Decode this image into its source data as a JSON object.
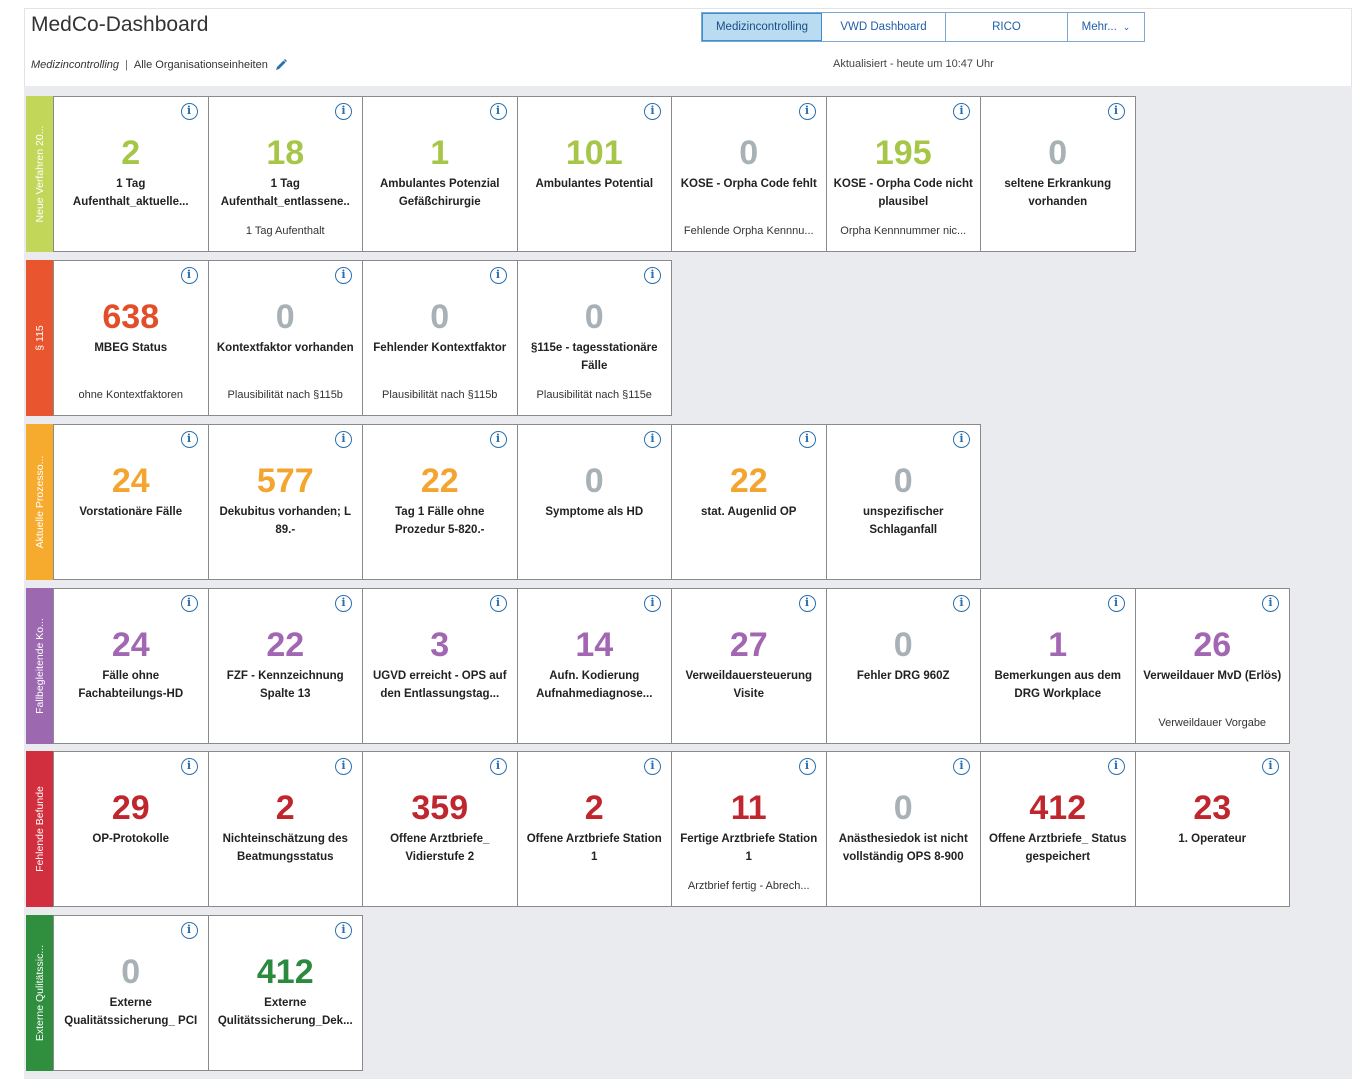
{
  "app": {
    "title": "MedCo-Dashboard",
    "context_label": "Medizincontrolling",
    "separator": "|",
    "org_label": "Alle Organisationseinheiten",
    "updated_text": "Aktualisiert - heute um 10:47 Uhr"
  },
  "tabs": [
    {
      "label": "Medizincontrolling",
      "active": true
    },
    {
      "label": "VWD Dashboard",
      "active": false
    },
    {
      "label": "RICO",
      "active": false
    },
    {
      "label": "Mehr...",
      "active": false
    }
  ],
  "colors": {
    "green": "#a6c648",
    "grey": "#a8b1b6",
    "orange_red": "#e24e2a",
    "orange": "#f4a530",
    "purple": "#a266b3",
    "red": "#c0262d",
    "dark_green": "#2a8a3e",
    "band_new": "#c2d75a",
    "band_115": "#e9552f",
    "band_process": "#f6ab2f",
    "band_case": "#9c68b0",
    "band_missing": "#d12e3e",
    "band_external": "#2f8f3e"
  },
  "rows": [
    {
      "band_label": "Neue Verfahren 20...",
      "band_color": "#c2d75a",
      "tiles": [
        {
          "value": "2",
          "color": "#a6c648",
          "label": "1 Tag Aufenthalt_aktuelle...",
          "sub": ""
        },
        {
          "value": "18",
          "color": "#a6c648",
          "label": "1 Tag Aufenthalt_entlassene..",
          "sub": "1 Tag Aufenthalt"
        },
        {
          "value": "1",
          "color": "#a6c648",
          "label": "Ambulantes Potenzial Gefäßchirurgie",
          "sub": ""
        },
        {
          "value": "101",
          "color": "#a6c648",
          "label": "Ambulantes Potential",
          "sub": ""
        },
        {
          "value": "0",
          "color": "#a8b1b6",
          "label": "KOSE - Orpha Code fehlt",
          "sub": "Fehlende Orpha Kennnu..."
        },
        {
          "value": "195",
          "color": "#a6c648",
          "label": "KOSE - Orpha Code nicht plausibel",
          "sub": "Orpha Kennnummer nic..."
        },
        {
          "value": "0",
          "color": "#a8b1b6",
          "label": "seltene Erkrankung vorhanden",
          "sub": ""
        }
      ]
    },
    {
      "band_label": "§ 115",
      "band_color": "#e9552f",
      "tiles": [
        {
          "value": "638",
          "color": "#e24e2a",
          "label": "MBEG Status",
          "sub": "ohne Kontextfaktoren"
        },
        {
          "value": "0",
          "color": "#a8b1b6",
          "label": "Kontextfaktor vorhanden",
          "sub": "Plausibilität nach §115b"
        },
        {
          "value": "0",
          "color": "#a8b1b6",
          "label": "Fehlender Kontextfaktor",
          "sub": "Plausibilität nach §115b"
        },
        {
          "value": "0",
          "color": "#a8b1b6",
          "label": "§115e - tagesstationäre Fälle",
          "sub": "Plausibilität nach §115e"
        }
      ]
    },
    {
      "band_label": "Aktuelle Prozesso...",
      "band_color": "#f6ab2f",
      "tiles": [
        {
          "value": "24",
          "color": "#f4a530",
          "label": "Vorstationäre Fälle",
          "sub": ""
        },
        {
          "value": "577",
          "color": "#f4a530",
          "label": "Dekubitus vorhanden; L 89.-",
          "sub": ""
        },
        {
          "value": "22",
          "color": "#f4a530",
          "label": "Tag 1 Fälle ohne Prozedur 5-820.-",
          "sub": ""
        },
        {
          "value": "0",
          "color": "#a8b1b6",
          "label": "Symptome als HD",
          "sub": ""
        },
        {
          "value": "22",
          "color": "#f4a530",
          "label": "stat. Augenlid OP",
          "sub": ""
        },
        {
          "value": "0",
          "color": "#a8b1b6",
          "label": "unspezifischer Schlaganfall",
          "sub": ""
        }
      ]
    },
    {
      "band_label": "Fallbegleitende Ko...",
      "band_color": "#9c68b0",
      "tiles": [
        {
          "value": "24",
          "color": "#a266b3",
          "label": "Fälle ohne Fachabteilungs-HD",
          "sub": ""
        },
        {
          "value": "22",
          "color": "#a266b3",
          "label": "FZF - Kennzeichnung Spalte 13",
          "sub": ""
        },
        {
          "value": "3",
          "color": "#a266b3",
          "label": "UGVD erreicht - OPS auf den Entlassungstag...",
          "sub": ""
        },
        {
          "value": "14",
          "color": "#a266b3",
          "label": "Aufn. Kodierung Aufnahmediagnose...",
          "sub": ""
        },
        {
          "value": "27",
          "color": "#a266b3",
          "label": "Verweildauersteuerung Visite",
          "sub": ""
        },
        {
          "value": "0",
          "color": "#a8b1b6",
          "label": "Fehler DRG 960Z",
          "sub": ""
        },
        {
          "value": "1",
          "color": "#a266b3",
          "label": "Bemerkungen aus dem DRG Workplace",
          "sub": ""
        },
        {
          "value": "26",
          "color": "#a266b3",
          "label": "Verweildauer MvD (Erlös)",
          "sub": "Verweildauer Vorgabe"
        }
      ]
    },
    {
      "band_label": "Fehlende Befunde",
      "band_color": "#d12e3e",
      "tiles": [
        {
          "value": "29",
          "color": "#c0262d",
          "label": "OP-Protokolle",
          "sub": ""
        },
        {
          "value": "2",
          "color": "#c0262d",
          "label": "Nichteinschätzung des Beatmungsstatus",
          "sub": ""
        },
        {
          "value": "359",
          "color": "#c0262d",
          "label": "Offene Arztbriefe_ Vidierstufe 2",
          "sub": ""
        },
        {
          "value": "2",
          "color": "#c0262d",
          "label": "Offene Arztbriefe Station 1",
          "sub": ""
        },
        {
          "value": "11",
          "color": "#c0262d",
          "label": "Fertige Arztbriefe Station 1",
          "sub": "Arztbrief fertig - Abrech..."
        },
        {
          "value": "0",
          "color": "#a8b1b6",
          "label": "Anästhesiedok ist nicht vollständig OPS 8-900",
          "sub": ""
        },
        {
          "value": "412",
          "color": "#c0262d",
          "label": "Offene Arztbriefe_ Status gespeichert",
          "sub": ""
        },
        {
          "value": "23",
          "color": "#c0262d",
          "label": "1. Operateur",
          "sub": ""
        }
      ]
    },
    {
      "band_label": "Externe Qulitätssic...",
      "band_color": "#2f8f3e",
      "tiles": [
        {
          "value": "0",
          "color": "#a8b1b6",
          "label": "Externe Qualitätssicherung_ PCI",
          "sub": ""
        },
        {
          "value": "412",
          "color": "#2a8a3e",
          "label": "Externe Qulitätssicherung_Dek...",
          "sub": ""
        }
      ]
    }
  ]
}
